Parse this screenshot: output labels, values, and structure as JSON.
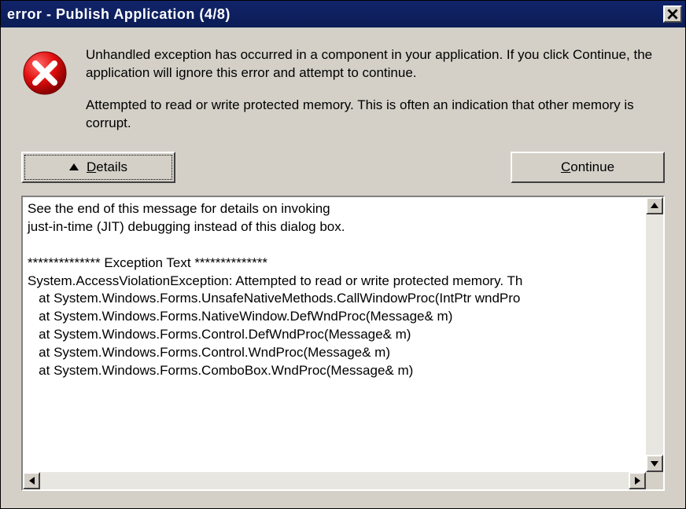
{
  "titlebar": {
    "title": "error - Publish Application (4/8)"
  },
  "message": {
    "line1": "Unhandled exception has occurred in a component in your application. If you click Continue, the application will ignore this error and attempt to continue.",
    "line2": "Attempted to read or write protected memory. This is often an indication that other memory is corrupt."
  },
  "buttons": {
    "details_pre": "",
    "details_mnemonic": "D",
    "details_post": "etails",
    "continue_pre": "",
    "continue_mnemonic": "C",
    "continue_post": "ontinue"
  },
  "details_text": "See the end of this message for details on invoking\njust-in-time (JIT) debugging instead of this dialog box.\n\n************** Exception Text **************\nSystem.AccessViolationException: Attempted to read or write protected memory. Th\n   at System.Windows.Forms.UnsafeNativeMethods.CallWindowProc(IntPtr wndPro\n   at System.Windows.Forms.NativeWindow.DefWndProc(Message& m)\n   at System.Windows.Forms.Control.DefWndProc(Message& m)\n   at System.Windows.Forms.Control.WndProc(Message& m)\n   at System.Windows.Forms.ComboBox.WndProc(Message& m)"
}
